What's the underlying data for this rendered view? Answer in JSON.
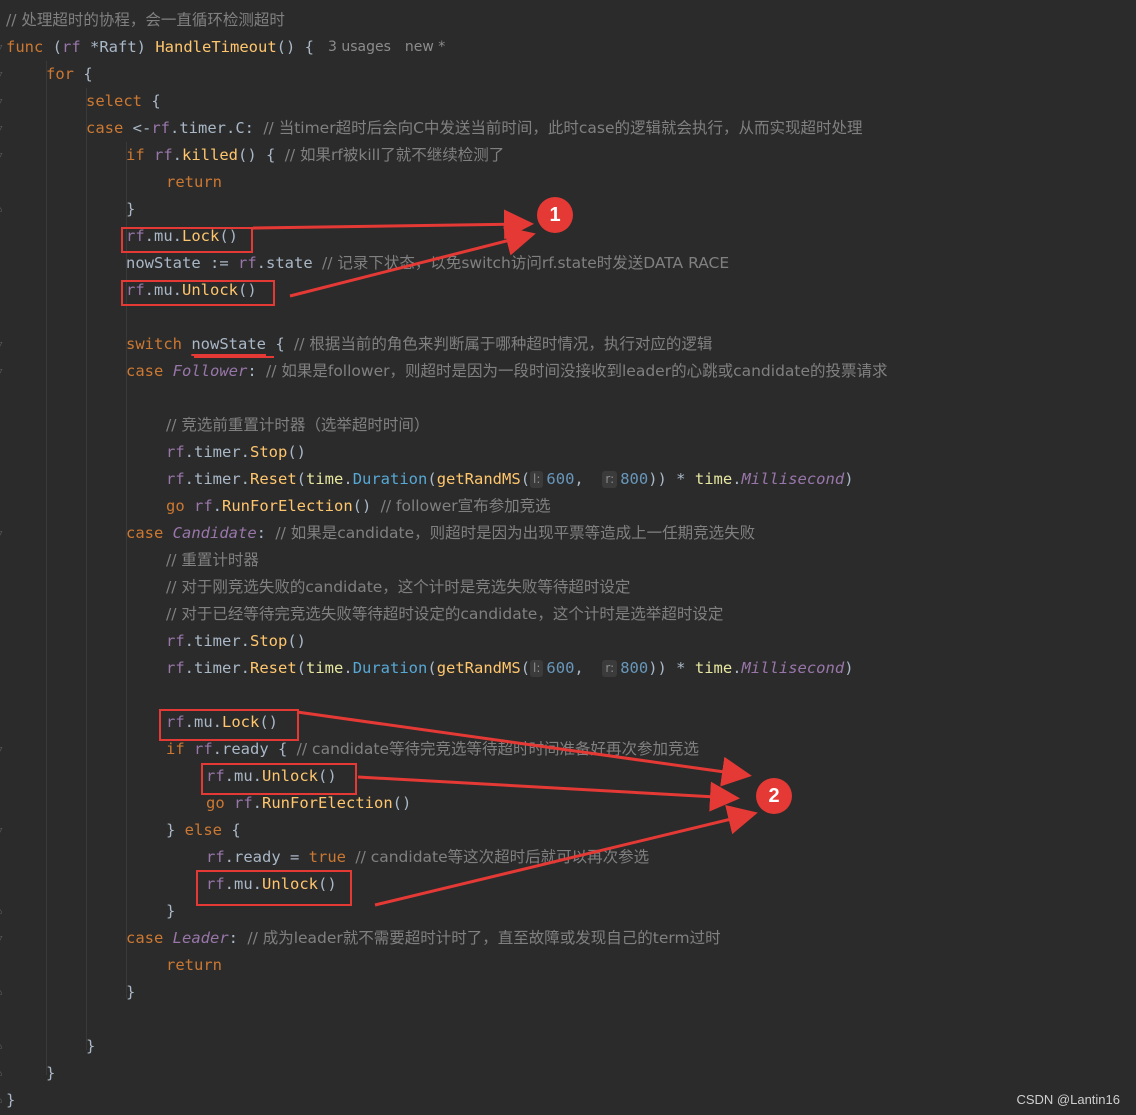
{
  "editor": {
    "lines": [
      {
        "tokens": [
          {
            "t": "cm-cn",
            "v": "// 处理超时的协程，会一直循环检测超时"
          }
        ]
      },
      {
        "tokens": [
          {
            "t": "kw",
            "v": "func "
          },
          {
            "t": "id",
            "v": "("
          },
          {
            "t": "var",
            "v": "rf"
          },
          {
            "t": "id",
            "v": " *Raft) "
          },
          {
            "t": "fn",
            "v": "HandleTimeout"
          },
          {
            "t": "id",
            "v": "() {"
          }
        ],
        "meta": [
          "3 usages",
          "new *"
        ]
      },
      {
        "tokens": [
          {
            "t": "kw",
            "v": "for"
          },
          {
            "t": "id",
            "v": " {"
          }
        ]
      },
      {
        "tokens": [
          {
            "t": "kw",
            "v": "select"
          },
          {
            "t": "id",
            "v": " {"
          }
        ]
      },
      {
        "tokens": [
          {
            "t": "kw",
            "v": "case"
          },
          {
            "t": "id",
            "v": " <-"
          },
          {
            "t": "var",
            "v": "rf"
          },
          {
            "t": "id",
            "v": ".timer.C: "
          },
          {
            "t": "cm-cn",
            "v": "// 当timer超时后会向C中发送当前时间，此时case的逻辑就会执行，从而实现超时处理"
          }
        ]
      },
      {
        "tokens": [
          {
            "t": "kw",
            "v": "if "
          },
          {
            "t": "var",
            "v": "rf"
          },
          {
            "t": "id",
            "v": "."
          },
          {
            "t": "call",
            "v": "killed"
          },
          {
            "t": "id",
            "v": "() { "
          },
          {
            "t": "cm-cn",
            "v": "// 如果rf被kill了就不继续检测了"
          }
        ]
      },
      {
        "tokens": [
          {
            "t": "kw",
            "v": "return"
          }
        ]
      },
      {
        "tokens": [
          {
            "t": "id",
            "v": "}"
          }
        ]
      },
      {
        "tokens": [
          {
            "t": "var",
            "v": "rf"
          },
          {
            "t": "id",
            "v": ".mu."
          },
          {
            "t": "call",
            "v": "Lock"
          },
          {
            "t": "id",
            "v": "()"
          }
        ]
      },
      {
        "tokens": [
          {
            "t": "id",
            "v": "nowState := "
          },
          {
            "t": "var",
            "v": "rf"
          },
          {
            "t": "id",
            "v": ".state "
          },
          {
            "t": "cm-cn",
            "v": "// 记录下状态，以免switch访问rf.state时发送DATA RACE"
          }
        ]
      },
      {
        "tokens": [
          {
            "t": "var",
            "v": "rf"
          },
          {
            "t": "id",
            "v": ".mu."
          },
          {
            "t": "call",
            "v": "Unlock"
          },
          {
            "t": "id",
            "v": "()"
          }
        ]
      },
      {
        "tokens": []
      },
      {
        "tokens": [
          {
            "t": "kw",
            "v": "switch "
          },
          {
            "t": "id u",
            "v": "nowState"
          },
          {
            "t": "id",
            "v": " { "
          },
          {
            "t": "cm-cn",
            "v": "// 根据当前的角色来判断属于哪种超时情况，执行对应的逻辑"
          }
        ]
      },
      {
        "tokens": [
          {
            "t": "kw",
            "v": "case "
          },
          {
            "t": "italic",
            "v": "Follower"
          },
          {
            "t": "id",
            "v": ": "
          },
          {
            "t": "cm-cn",
            "v": "// 如果是follower，则超时是因为一段时间没接收到leader的心跳或candidate的投票请求"
          }
        ]
      },
      {
        "tokens": []
      },
      {
        "tokens": [
          {
            "t": "cm-cn",
            "v": "// 竞选前重置计时器（选举超时时间）"
          }
        ]
      },
      {
        "tokens": [
          {
            "t": "var",
            "v": "rf"
          },
          {
            "t": "id",
            "v": ".timer."
          },
          {
            "t": "call",
            "v": "Stop"
          },
          {
            "t": "id",
            "v": "()"
          }
        ]
      },
      {
        "tokens": [
          {
            "t": "var",
            "v": "rf"
          },
          {
            "t": "id",
            "v": ".timer."
          },
          {
            "t": "call",
            "v": "Reset"
          },
          {
            "t": "id",
            "v": "("
          },
          {
            "t": "pkg",
            "v": "time"
          },
          {
            "t": "id",
            "v": "."
          },
          {
            "t": "method",
            "v": "Duration"
          },
          {
            "t": "id",
            "v": "("
          },
          {
            "t": "call",
            "v": "getRandMS"
          },
          {
            "t": "id",
            "v": "("
          },
          {
            "t": "hint",
            "v": "l:"
          },
          {
            "t": "num",
            "v": "600"
          },
          {
            "t": "id",
            "v": ",  "
          },
          {
            "t": "hint",
            "v": "r:"
          },
          {
            "t": "num",
            "v": "800"
          },
          {
            "t": "id",
            "v": ")) * "
          },
          {
            "t": "pkg",
            "v": "time"
          },
          {
            "t": "id",
            "v": "."
          },
          {
            "t": "italic",
            "v": "Millisecond"
          },
          {
            "t": "id",
            "v": ")"
          }
        ]
      },
      {
        "tokens": [
          {
            "t": "kw",
            "v": "go "
          },
          {
            "t": "var",
            "v": "rf"
          },
          {
            "t": "id",
            "v": "."
          },
          {
            "t": "call",
            "v": "RunForElection"
          },
          {
            "t": "id",
            "v": "() "
          },
          {
            "t": "cm-cn",
            "v": "// follower宣布参加竞选"
          }
        ]
      },
      {
        "tokens": [
          {
            "t": "kw",
            "v": "case "
          },
          {
            "t": "italic",
            "v": "Candidate"
          },
          {
            "t": "id",
            "v": ": "
          },
          {
            "t": "cm-cn",
            "v": "// 如果是candidate，则超时是因为出现平票等造成上一任期竞选失败"
          }
        ]
      },
      {
        "tokens": [
          {
            "t": "cm-cn",
            "v": "// 重置计时器"
          }
        ]
      },
      {
        "tokens": [
          {
            "t": "cm-cn",
            "v": "// 对于刚竞选失败的candidate，这个计时是竞选失败等待超时设定"
          }
        ]
      },
      {
        "tokens": [
          {
            "t": "cm-cn",
            "v": "// 对于已经等待完竞选失败等待超时设定的candidate，这个计时是选举超时设定"
          }
        ]
      },
      {
        "tokens": [
          {
            "t": "var",
            "v": "rf"
          },
          {
            "t": "id",
            "v": ".timer."
          },
          {
            "t": "call",
            "v": "Stop"
          },
          {
            "t": "id",
            "v": "()"
          }
        ]
      },
      {
        "tokens": [
          {
            "t": "var",
            "v": "rf"
          },
          {
            "t": "id",
            "v": ".timer."
          },
          {
            "t": "call",
            "v": "Reset"
          },
          {
            "t": "id",
            "v": "("
          },
          {
            "t": "pkg",
            "v": "time"
          },
          {
            "t": "id",
            "v": "."
          },
          {
            "t": "method",
            "v": "Duration"
          },
          {
            "t": "id",
            "v": "("
          },
          {
            "t": "call",
            "v": "getRandMS"
          },
          {
            "t": "id",
            "v": "("
          },
          {
            "t": "hint",
            "v": "l:"
          },
          {
            "t": "num",
            "v": "600"
          },
          {
            "t": "id",
            "v": ",  "
          },
          {
            "t": "hint",
            "v": "r:"
          },
          {
            "t": "num",
            "v": "800"
          },
          {
            "t": "id",
            "v": ")) * "
          },
          {
            "t": "pkg",
            "v": "time"
          },
          {
            "t": "id",
            "v": "."
          },
          {
            "t": "italic",
            "v": "Millisecond"
          },
          {
            "t": "id",
            "v": ")"
          }
        ]
      },
      {
        "tokens": []
      },
      {
        "tokens": [
          {
            "t": "var",
            "v": "rf"
          },
          {
            "t": "id",
            "v": ".mu."
          },
          {
            "t": "call",
            "v": "Lock"
          },
          {
            "t": "id",
            "v": "()"
          }
        ]
      },
      {
        "tokens": [
          {
            "t": "kw",
            "v": "if "
          },
          {
            "t": "var",
            "v": "rf"
          },
          {
            "t": "id",
            "v": ".ready { "
          },
          {
            "t": "cm-cn",
            "v": "// candidate等待完竞选等待超时时间准备好再次参加竞选"
          }
        ]
      },
      {
        "tokens": [
          {
            "t": "var",
            "v": "rf"
          },
          {
            "t": "id",
            "v": ".mu."
          },
          {
            "t": "call",
            "v": "Unlock"
          },
          {
            "t": "id",
            "v": "()"
          }
        ]
      },
      {
        "tokens": [
          {
            "t": "kw",
            "v": "go "
          },
          {
            "t": "var",
            "v": "rf"
          },
          {
            "t": "id",
            "v": "."
          },
          {
            "t": "call",
            "v": "RunForElection"
          },
          {
            "t": "id",
            "v": "()"
          }
        ]
      },
      {
        "tokens": [
          {
            "t": "id",
            "v": "} "
          },
          {
            "t": "kw",
            "v": "else"
          },
          {
            "t": "id",
            "v": " {"
          }
        ]
      },
      {
        "tokens": [
          {
            "t": "var",
            "v": "rf"
          },
          {
            "t": "id",
            "v": ".ready = "
          },
          {
            "t": "kw",
            "v": "true"
          },
          {
            "t": "id",
            "v": " "
          },
          {
            "t": "cm-cn",
            "v": "// candidate等这次超时后就可以再次参选"
          }
        ]
      },
      {
        "tokens": [
          {
            "t": "var",
            "v": "rf"
          },
          {
            "t": "id",
            "v": ".mu."
          },
          {
            "t": "call",
            "v": "Unlock"
          },
          {
            "t": "id",
            "v": "()"
          }
        ]
      },
      {
        "tokens": [
          {
            "t": "id",
            "v": "}"
          }
        ]
      },
      {
        "tokens": [
          {
            "t": "kw",
            "v": "case "
          },
          {
            "t": "italic",
            "v": "Leader"
          },
          {
            "t": "id",
            "v": ": "
          },
          {
            "t": "cm-cn",
            "v": "// 成为leader就不需要超时计时了，直至故障或发现自己的term过时"
          }
        ]
      },
      {
        "tokens": [
          {
            "t": "kw",
            "v": "return"
          }
        ]
      },
      {
        "tokens": [
          {
            "t": "id",
            "v": "}"
          }
        ]
      },
      {
        "tokens": []
      },
      {
        "tokens": [
          {
            "t": "id",
            "v": "}"
          }
        ]
      },
      {
        "tokens": [
          {
            "t": "id",
            "v": "}"
          }
        ]
      },
      {
        "tokens": [
          {
            "t": "id",
            "v": "}"
          }
        ]
      }
    ]
  },
  "annotations": {
    "marker_1": "1",
    "marker_2": "2",
    "color": "#e53935"
  },
  "watermark": "CSDN @Lantin16",
  "colors": {
    "background": "#2b2b2b",
    "keyword": "#cc7832",
    "function": "#ffc66d",
    "comment": "#808080",
    "receiver": "#9876aa",
    "number": "#6897bb"
  }
}
